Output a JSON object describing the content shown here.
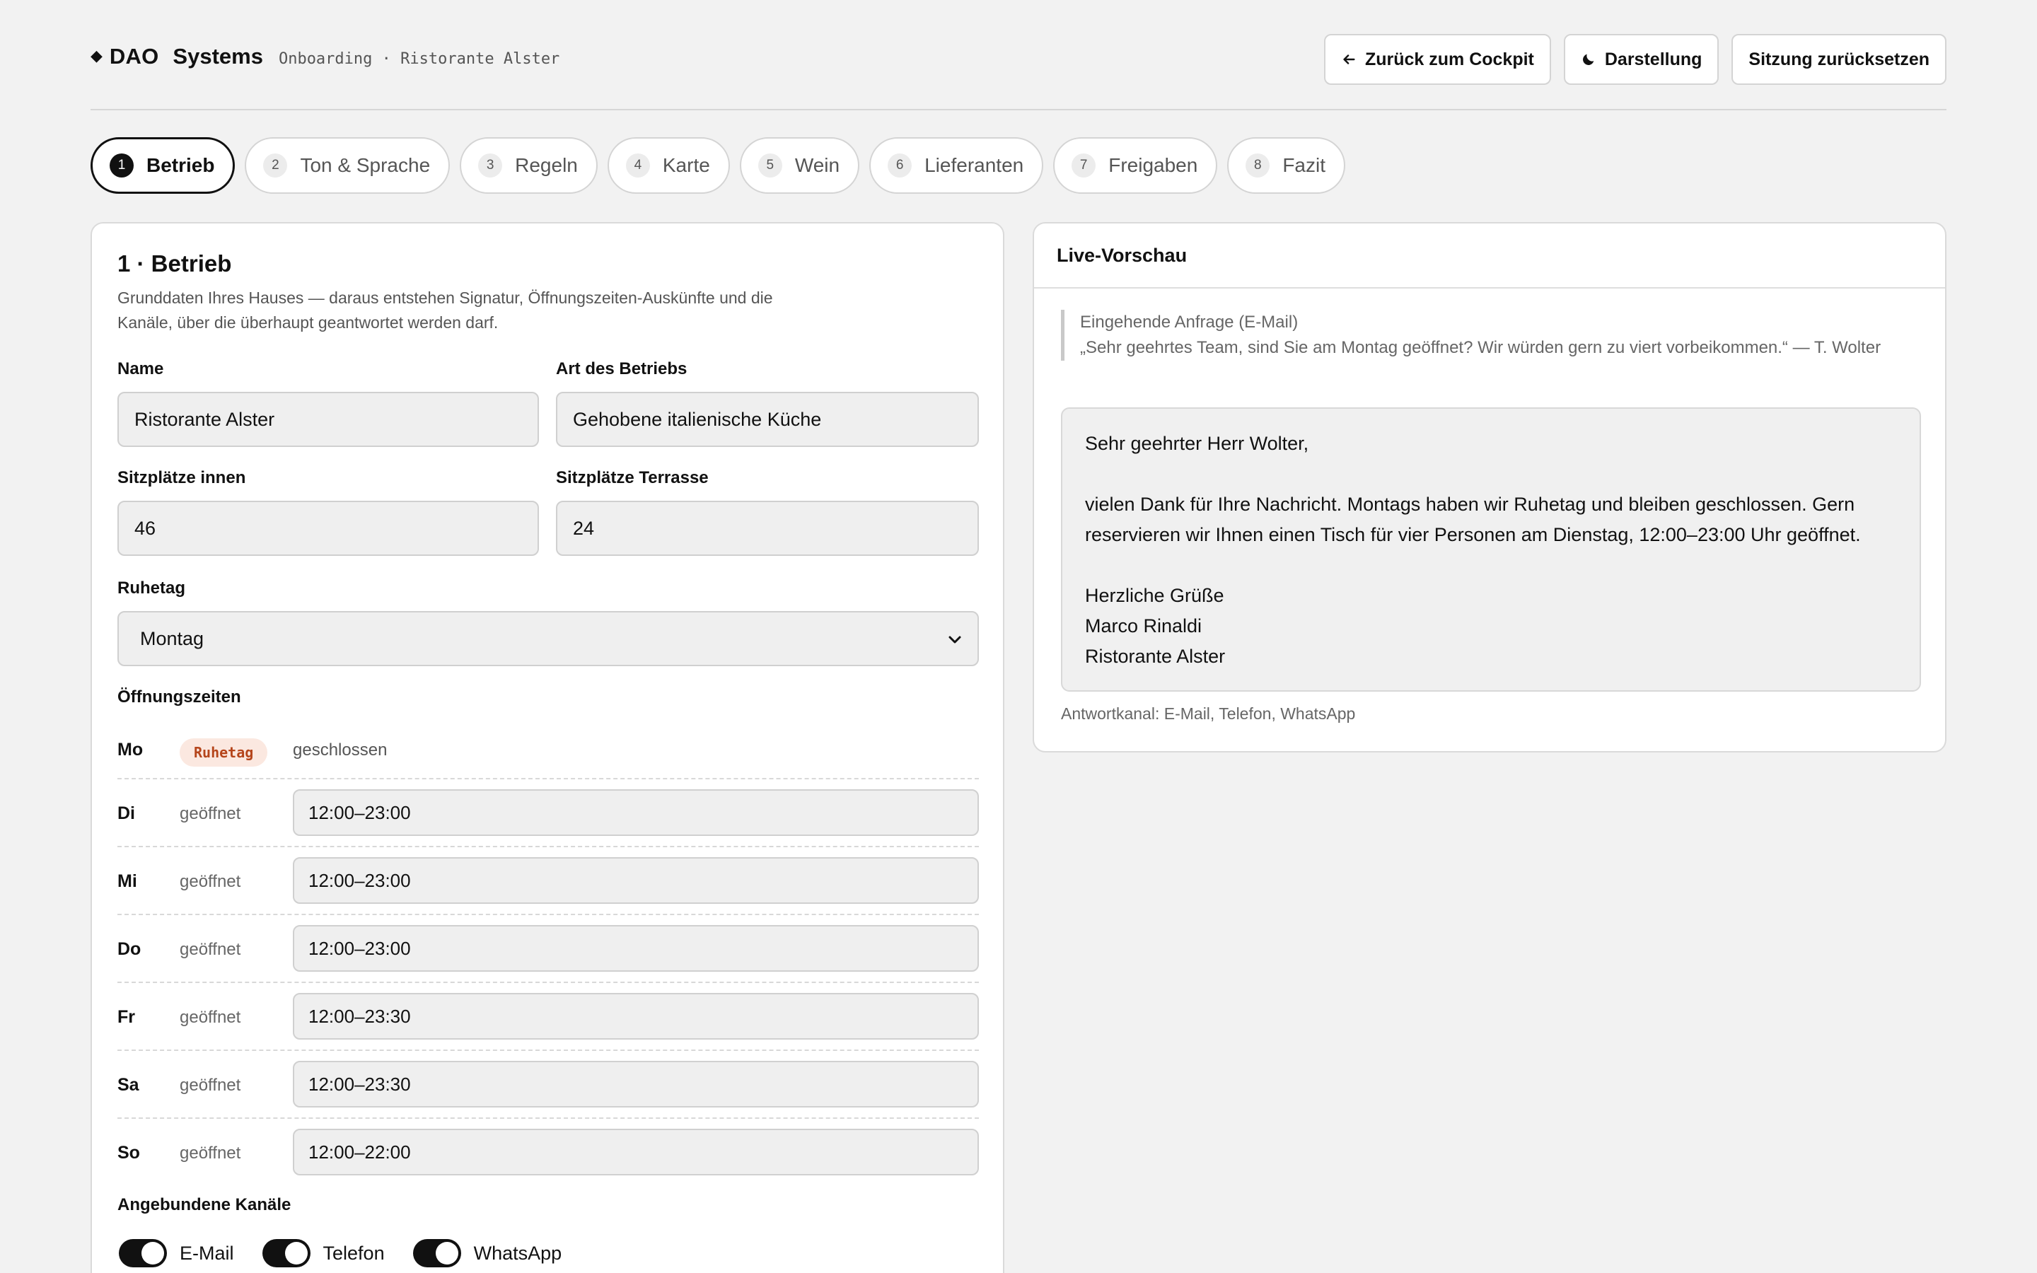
{
  "brand": {
    "name": "DAO",
    "name2": "Systems",
    "subtitle": "Onboarding · Ristorante Alster"
  },
  "header_actions": {
    "back": "Zurück zum Cockpit",
    "appearance": "Darstellung",
    "reset": "Sitzung zurücksetzen"
  },
  "steps": [
    {
      "num": "1",
      "label": "Betrieb",
      "active": true
    },
    {
      "num": "2",
      "label": "Ton & Sprache"
    },
    {
      "num": "3",
      "label": "Regeln"
    },
    {
      "num": "4",
      "label": "Karte"
    },
    {
      "num": "5",
      "label": "Wein"
    },
    {
      "num": "6",
      "label": "Lieferanten"
    },
    {
      "num": "7",
      "label": "Freigaben"
    },
    {
      "num": "8",
      "label": "Fazit"
    }
  ],
  "form": {
    "title": "1 · Betrieb",
    "description": "Grunddaten Ihres Hauses — daraus entstehen Signatur, Öffnungszeiten-Auskünfte und die Kanäle, über die überhaupt geantwortet werden darf.",
    "name_label": "Name",
    "name_value": "Ristorante Alster",
    "type_label": "Art des Betriebs",
    "type_value": "Gehobene italienische Küche",
    "seats_in_label": "Sitzplätze innen",
    "seats_in_value": "46",
    "seats_out_label": "Sitzplätze Terrasse",
    "seats_out_value": "24",
    "rest_day_label": "Ruhetag",
    "rest_day_value": "Montag",
    "hours_label": "Öffnungszeiten",
    "hours": [
      {
        "day": "Mo",
        "badge": "Ruhetag",
        "status": "geschlossen"
      },
      {
        "day": "Di",
        "status": "geöffnet",
        "value": "12:00–23:00"
      },
      {
        "day": "Mi",
        "status": "geöffnet",
        "value": "12:00–23:00"
      },
      {
        "day": "Do",
        "status": "geöffnet",
        "value": "12:00–23:00"
      },
      {
        "day": "Fr",
        "status": "geöffnet",
        "value": "12:00–23:30"
      },
      {
        "day": "Sa",
        "status": "geöffnet",
        "value": "12:00–23:30"
      },
      {
        "day": "So",
        "status": "geöffnet",
        "value": "12:00–22:00"
      }
    ],
    "channels_label": "Angebundene Kanäle",
    "channels": [
      {
        "label": "E-Mail",
        "on": true
      },
      {
        "label": "Telefon",
        "on": true
      },
      {
        "label": "WhatsApp",
        "on": true
      }
    ]
  },
  "preview": {
    "title": "Live-Vorschau",
    "inquiry_title": "Eingehende Anfrage (E-Mail)",
    "inquiry_text": "„Sehr geehrtes Team, sind Sie am Montag geöffnet? Wir würden gern zu viert vorbeikommen.“ — T. Wolter",
    "reply_greeting": "Sehr geehrter Herr Wolter,",
    "reply_body": "vielen Dank für Ihre Nachricht. Montags haben wir Ruhetag und bleiben geschlossen. Gern reservieren wir Ihnen einen Tisch für vier Personen am Dienstag, 12:00–23:00 Uhr geöffnet.",
    "reply_closing": "Herzliche Grüße",
    "reply_name": "Marco Rinaldi",
    "reply_company": "Ristorante Alster",
    "channels_note": "Antwortkanal: E-Mail, Telefon, WhatsApp"
  },
  "icons": {
    "brand": "diamond-icon",
    "back": "arrow-left-icon",
    "appearance": "moon-icon",
    "select": "chevron-down-icon"
  },
  "colors": {
    "background": "#f2f2f2",
    "accent": "#111111",
    "badge_bg": "#fbe8e0",
    "badge_text": "#b5451b"
  }
}
